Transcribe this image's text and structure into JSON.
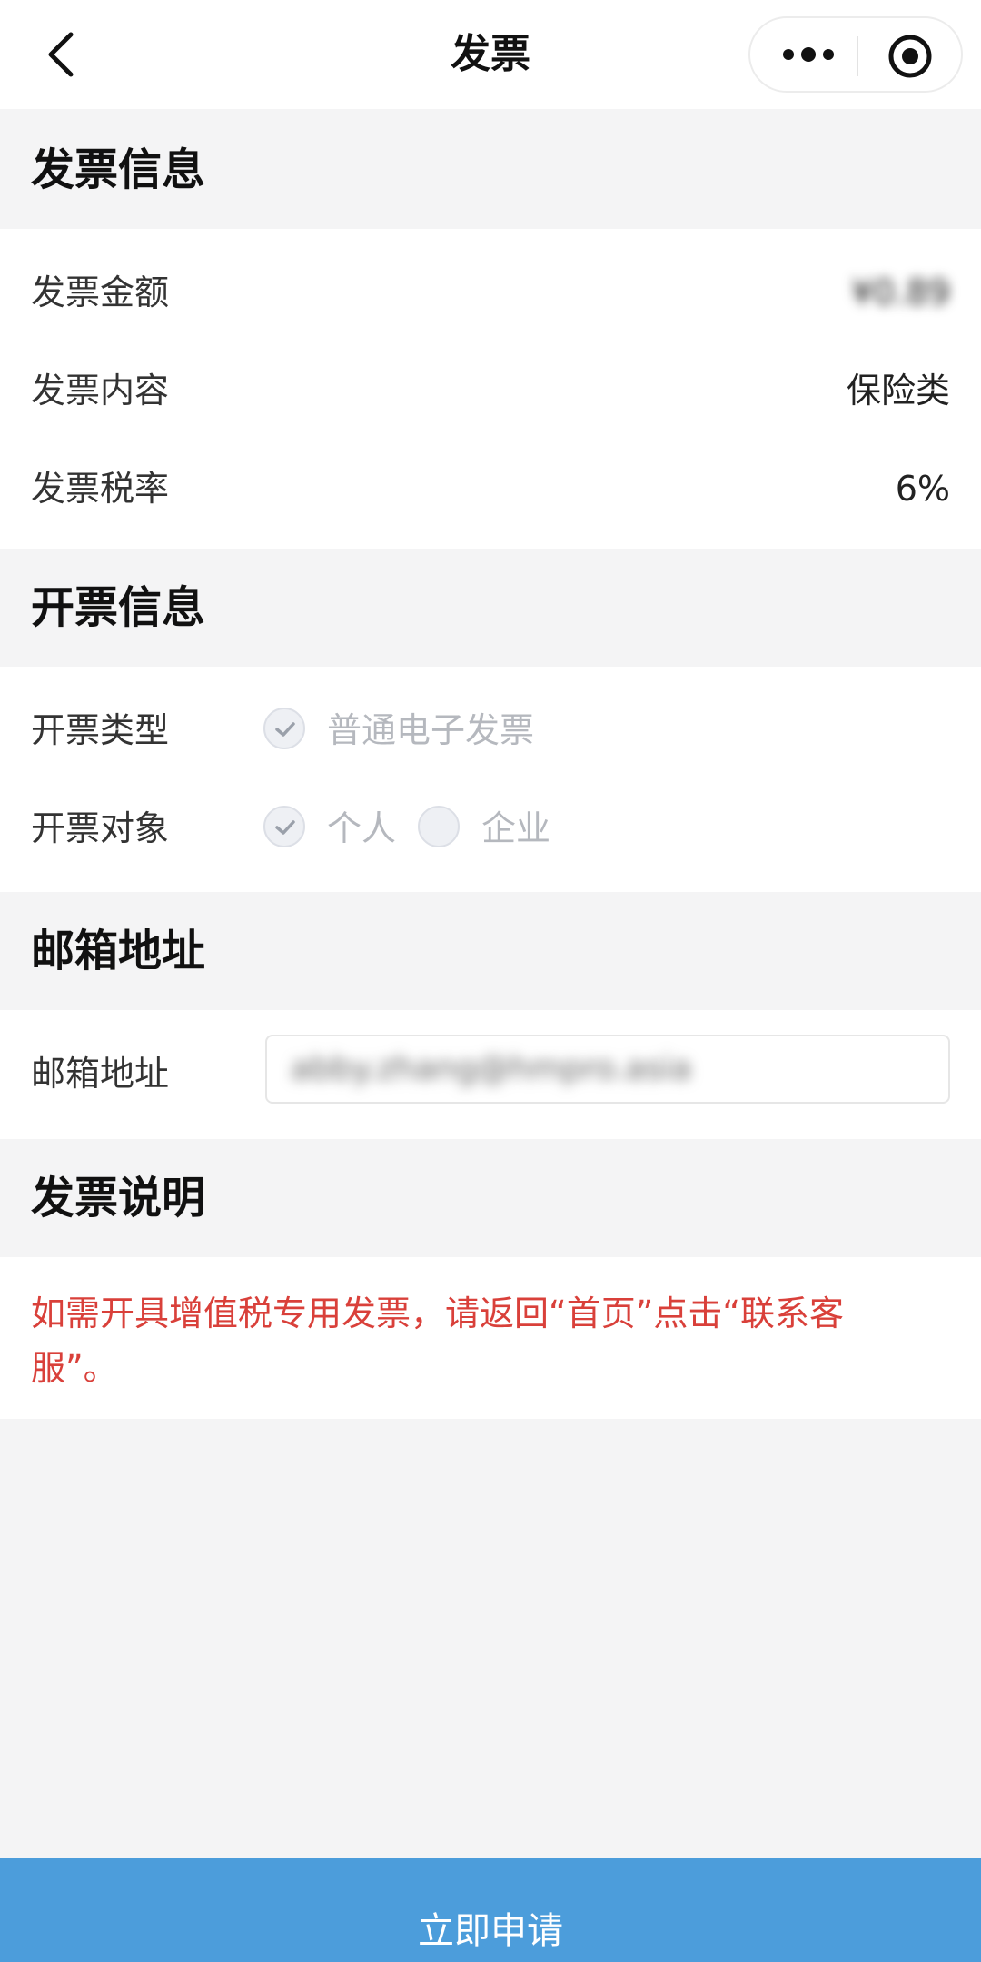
{
  "nav": {
    "title": "发票"
  },
  "sections": {
    "invoice_info": {
      "title": "发票信息",
      "rows": [
        {
          "label": "发票金额",
          "value": "¥0.89"
        },
        {
          "label": "发票内容",
          "value": "保险类"
        },
        {
          "label": "发票税率",
          "value": "6%"
        }
      ]
    },
    "issue_info": {
      "title": "开票信息",
      "type_label": "开票类型",
      "type_option": "普通电子发票",
      "target_label": "开票对象",
      "target_options": [
        "个人",
        "企业"
      ],
      "target_selected": "个人"
    },
    "email": {
      "title": "邮箱地址",
      "label": "邮箱地址",
      "value": "abby.zhang@hmpro.asia"
    },
    "notes": {
      "title": "发票说明",
      "text": "如需开具增值税专用发票，请返回“首页”点击“联系客服”。"
    }
  },
  "footer": {
    "apply_label": "立即申请"
  },
  "colors": {
    "accent": "#4c9ddb",
    "note": "#d9403a"
  }
}
